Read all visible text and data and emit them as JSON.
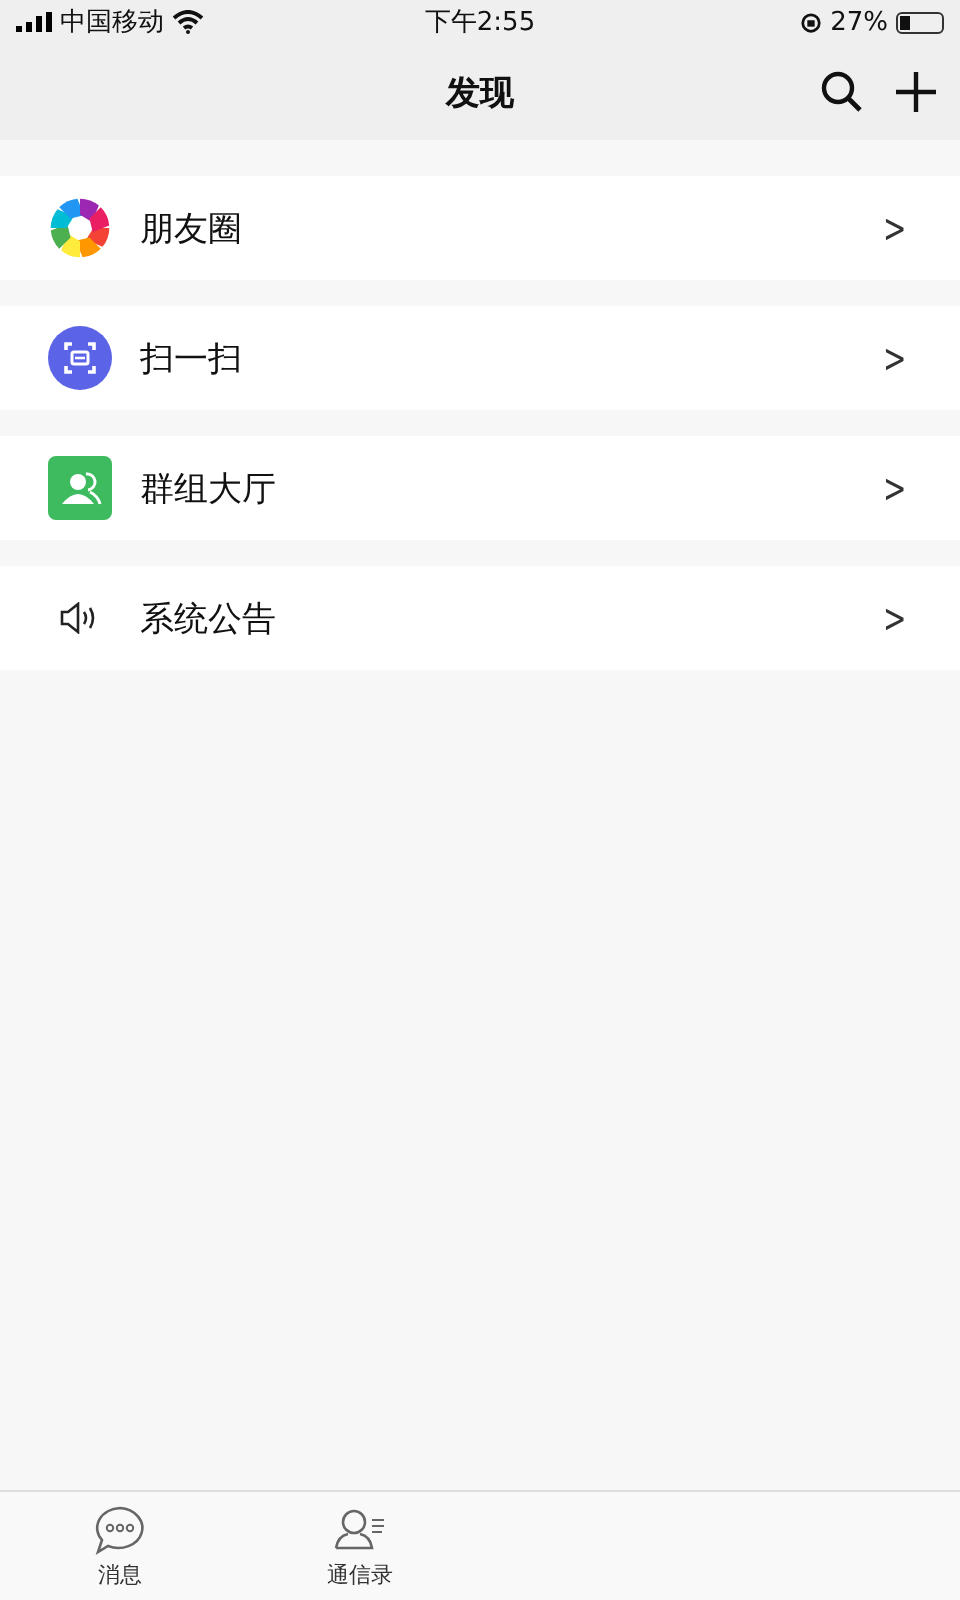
{
  "status_bar": {
    "carrier": "中国移动",
    "time": "下午2:55",
    "battery": "27%"
  },
  "nav": {
    "title": "发现"
  },
  "items": [
    {
      "kind": "moments",
      "label": "朋友圈",
      "chevron": ">"
    },
    {
      "kind": "scan",
      "label": "扫一扫",
      "chevron": ">"
    },
    {
      "kind": "group",
      "label": "群组大厅",
      "chevron": ">"
    },
    {
      "kind": "announce",
      "label": "系统公告",
      "chevron": ">"
    }
  ],
  "tabs": [
    {
      "kind": "chat",
      "label": "消息"
    },
    {
      "kind": "contacts",
      "label": "通信录"
    }
  ]
}
